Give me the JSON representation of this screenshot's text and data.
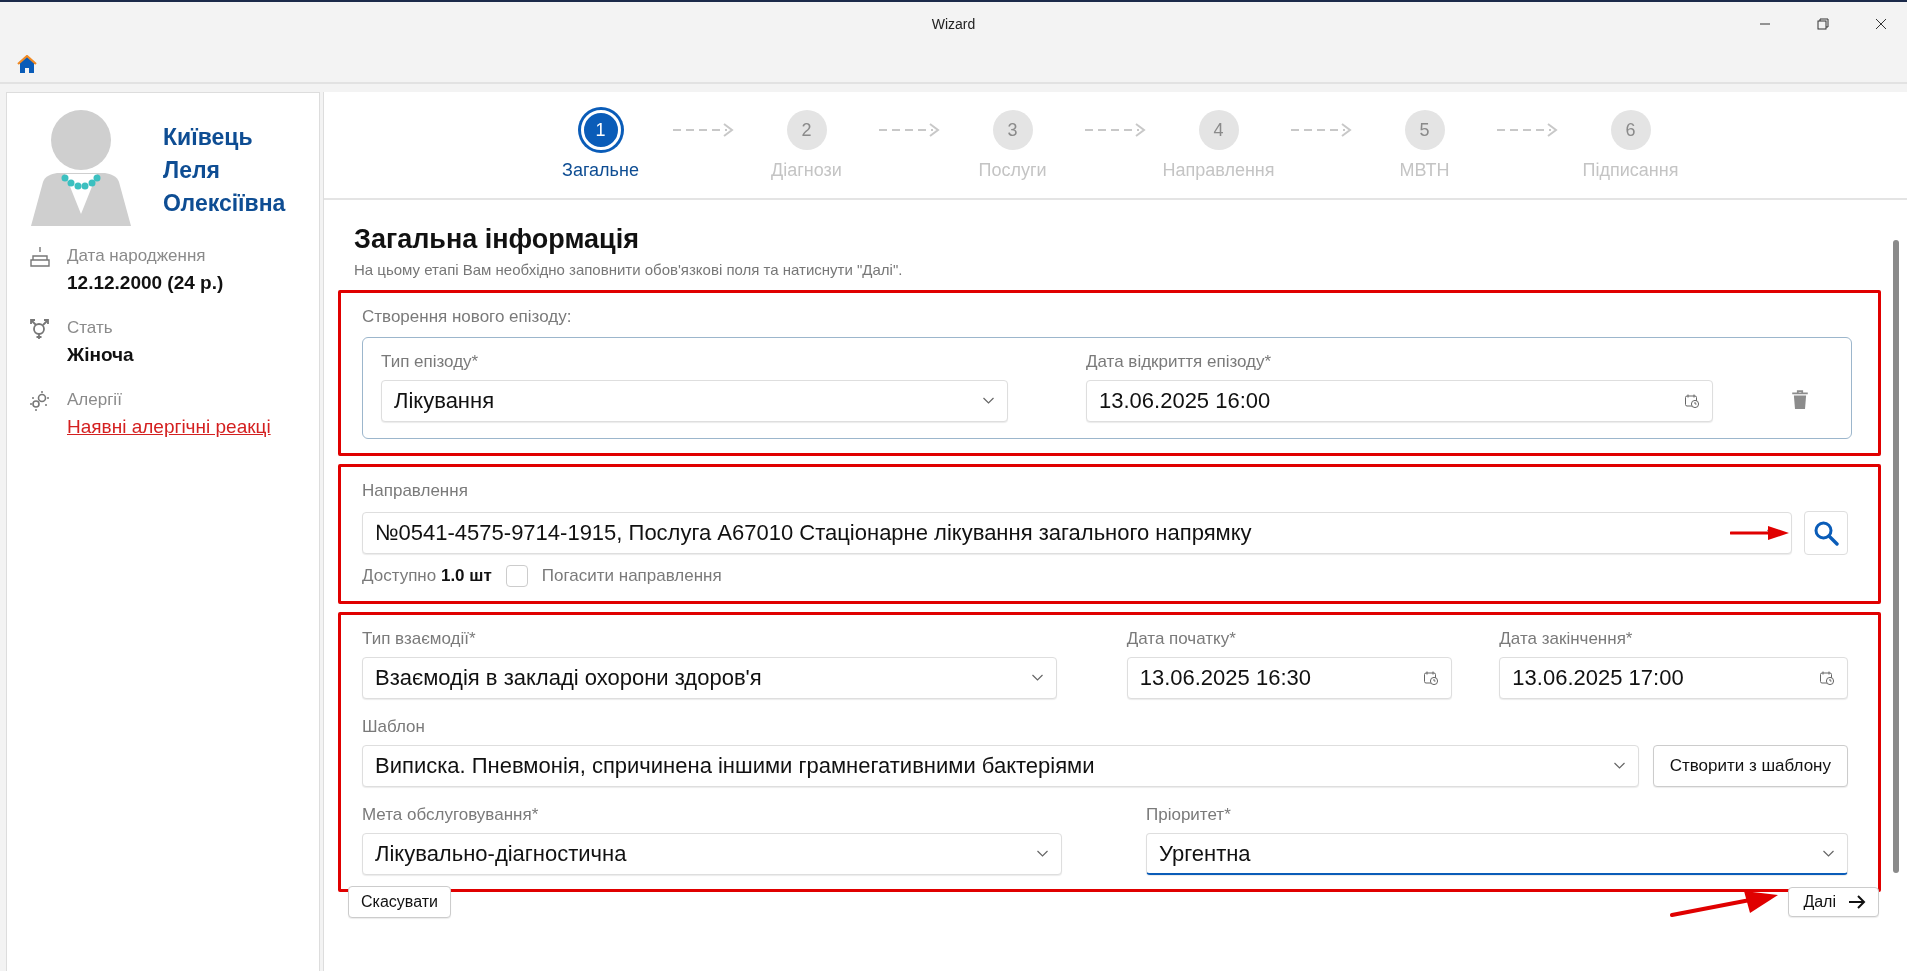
{
  "window": {
    "title": "Wizard"
  },
  "patient": {
    "name_lines": [
      "Київець",
      "Леля",
      "Олексіївна"
    ],
    "details": [
      {
        "kind": "birth",
        "label": "Дата народження",
        "value": "12.12.2000 (24 р.)"
      },
      {
        "kind": "gender",
        "label": "Стать",
        "value": "Жіноча"
      },
      {
        "kind": "allergy",
        "label": "Алергії",
        "link": "Наявні алергічні реакці"
      }
    ]
  },
  "steps": [
    {
      "number": "1",
      "label": "Загальне",
      "selected": true
    },
    {
      "number": "2",
      "label": "Діагнози",
      "selected": false
    },
    {
      "number": "3",
      "label": "Послуги",
      "selected": false
    },
    {
      "number": "4",
      "label": "Направлення",
      "selected": false
    },
    {
      "number": "5",
      "label": "МВТН",
      "selected": false
    },
    {
      "number": "6",
      "label": "Підписання",
      "selected": false
    }
  ],
  "form": {
    "heading": "Загальна інформація",
    "subtitle": "На цьому етапі Вам необхідно заповнити обов'язкові поля та натиснути \"Далі\".",
    "episode": {
      "caption": "Створення нового епізоду:",
      "type": {
        "label": "Тип епізоду*",
        "value": "Лікування"
      },
      "date": {
        "label": "Дата відкриття епізоду*",
        "value": "13.06.2025 16:00"
      }
    },
    "referral": {
      "label": "Направлення",
      "value": "№0541-4575-9714-1915, Послуга A67010 Стаціонарне лікування загального напрямку",
      "available_label": "Доступно",
      "available_value": "1.0 шт",
      "cancel_checkbox": {
        "label": "Погасити направлення",
        "checked": false
      }
    },
    "interaction": {
      "label": "Тип взаємодії*",
      "value": "Взаємодія в закладі охорони здоров'я"
    },
    "start": {
      "label": "Дата початку*",
      "value": "13.06.2025 16:30"
    },
    "end": {
      "label": "Дата закінчення*",
      "value": "13.06.2025 17:00"
    },
    "template": {
      "label": "Шаблон",
      "value": "Виписка. Пневмонія, спричинена іншими грамнегативними бактеріями",
      "button": "Створити з шаблону"
    },
    "purpose": {
      "label": "Мета обслуговування*",
      "value": "Лікувально-діагностична",
      "focused": false
    },
    "priority": {
      "label": "Пріоритет*",
      "value": "Ургентна",
      "focused": true
    }
  },
  "buttons": {
    "cancel": "Скасувати",
    "next": "Далі"
  }
}
